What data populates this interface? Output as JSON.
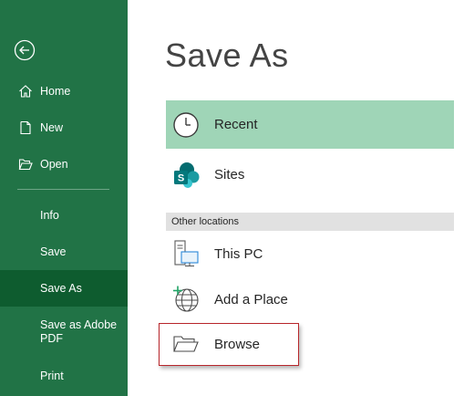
{
  "sidebar": {
    "back_icon": "back-arrow-icon",
    "items": [
      {
        "label": "Home",
        "icon": "home-icon"
      },
      {
        "label": "New",
        "icon": "new-document-icon"
      },
      {
        "label": "Open",
        "icon": "open-folder-icon"
      },
      {
        "label": "Info"
      },
      {
        "label": "Save"
      },
      {
        "label": "Save As",
        "active": true
      },
      {
        "label": "Save as Adobe PDF"
      },
      {
        "label": "Print"
      }
    ],
    "colors": {
      "background": "#217346",
      "active": "#0e5c2f",
      "text": "#ffffff"
    }
  },
  "main": {
    "title": "Save As",
    "locations": [
      {
        "label": "Recent",
        "icon": "clock-icon",
        "selected": true
      },
      {
        "label": "Sites",
        "icon": "sharepoint-icon"
      }
    ],
    "other_locations_header": "Other locations",
    "other_locations": [
      {
        "label": "This PC",
        "icon": "computer-icon"
      },
      {
        "label": "Add a Place",
        "icon": "globe-add-icon"
      },
      {
        "label": "Browse",
        "icon": "folder-icon",
        "highlighted": true
      }
    ],
    "colors": {
      "selected": "#9fd5b7",
      "section_header": "#e1e1e1",
      "highlight_border": "#b8262b"
    }
  }
}
